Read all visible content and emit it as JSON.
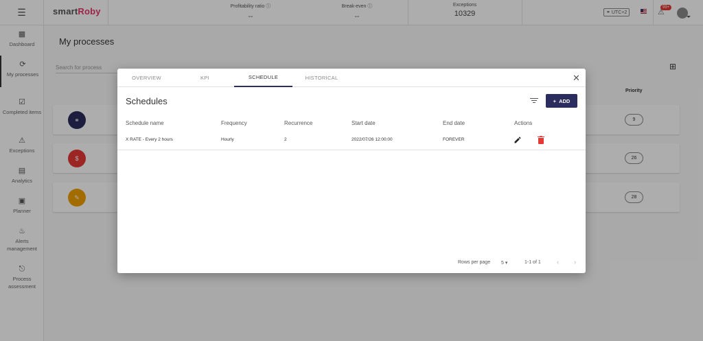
{
  "app": {
    "logo_prefix": "smart",
    "logo_accent": "Roby",
    "menu_icon": "menu-icon"
  },
  "header_kpis": [
    {
      "label": "Profitability ratio",
      "value": "--"
    },
    {
      "label": "Break-even",
      "value": "--"
    },
    {
      "label": "Exceptions",
      "value": "10329"
    }
  ],
  "header_right": {
    "timezone": "UTC+2",
    "notifications_badge": "99+"
  },
  "sidebar": {
    "items": [
      {
        "label": "Dashboard",
        "icon": "dashboard-icon"
      },
      {
        "label": "My processes",
        "icon": "processes-icon",
        "active": true
      },
      {
        "label": "Completed items",
        "icon": "check-icon"
      },
      {
        "label": "Exceptions",
        "icon": "warning-icon"
      },
      {
        "label": "Analytics",
        "icon": "analytics-icon"
      },
      {
        "label": "Planner",
        "icon": "calendar-icon"
      },
      {
        "label": "Alerts management",
        "icon": "bell-icon"
      },
      {
        "label": "Process assessment",
        "icon": "assessment-icon"
      }
    ]
  },
  "main": {
    "title": "My processes",
    "search_placeholder": "Search for process",
    "priority_header": "Priority",
    "processes": [
      {
        "avatar_color": "#2b2d5e",
        "icon": "globe-icon",
        "priority": "9"
      },
      {
        "avatar_color": "#e53935",
        "icon": "coin-icon",
        "priority": "26"
      },
      {
        "avatar_color": "#f0a000",
        "icon": "document-icon",
        "priority": "28"
      }
    ]
  },
  "dialog": {
    "tabs": [
      {
        "label": "OVERVIEW",
        "active": false
      },
      {
        "label": "KPI",
        "active": false
      },
      {
        "label": "SCHEDULE",
        "active": true
      },
      {
        "label": "HISTORICAL",
        "active": false
      }
    ],
    "title": "Schedules",
    "add_label": "ADD",
    "columns": [
      "Schedule name",
      "Frequency",
      "Recurrence",
      "Start date",
      "End date",
      "Actions"
    ],
    "rows": [
      {
        "name": "X RATE - Every 2 hours",
        "frequency": "Hourly",
        "recurrence": "2",
        "start_date": "2022/07/26 12:00:00",
        "end_date": "FOREVER"
      }
    ],
    "footer": {
      "rows_per_page_label": "Rows per page",
      "rows_per_page_value": "5",
      "range": "1-1 of 1"
    }
  },
  "colors": {
    "primary": "#2b2d5e",
    "logo_accent": "#e8336b",
    "delete": "#e53935"
  }
}
